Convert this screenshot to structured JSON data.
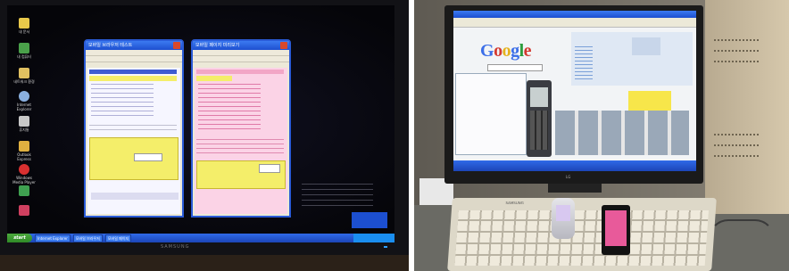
{
  "left_photo": {
    "desktop_icons": [
      "내 문서",
      "내 컴퓨터",
      "네트워크 환경",
      "Internet Explorer",
      "휴지통",
      "Outlook Express",
      "Windows Media Player"
    ],
    "windows": [
      {
        "title": "모바일 브라우저 테스트",
        "theme": "blue",
        "accent": "#2a5bd7",
        "body": "#f6f6ff",
        "highlight": "#3e5cd2",
        "note_bg": "#f4ee6a"
      },
      {
        "title": "모바일 페이지 미리보기",
        "theme": "pink",
        "accent": "#2a5bd7",
        "body": "#fbd3e6",
        "highlight": "#f2a6c6",
        "note_bg": "#f4ee6a"
      }
    ],
    "taskbar": {
      "start": "start",
      "items": [
        "Internet Explorer",
        "모바일 브라우저",
        "모바일 페이지"
      ]
    },
    "monitor_brand": "SAMSUNG"
  },
  "right_photo": {
    "screen_logo": {
      "letters": [
        "G",
        "o",
        "o",
        "g",
        "l",
        "e"
      ],
      "colors": [
        "#3b6ee8",
        "#d3382f",
        "#e5b21d",
        "#3b6ee8",
        "#2c9c3e",
        "#d3382f"
      ]
    },
    "monitor_brand": "LG",
    "keyboard_brand": "SAMSUNG",
    "phones": [
      "flip-phone",
      "touch-phone"
    ],
    "accent_colors": {
      "page_yellow": "#f7e64a",
      "phone_screen": "#e85a9a"
    }
  }
}
